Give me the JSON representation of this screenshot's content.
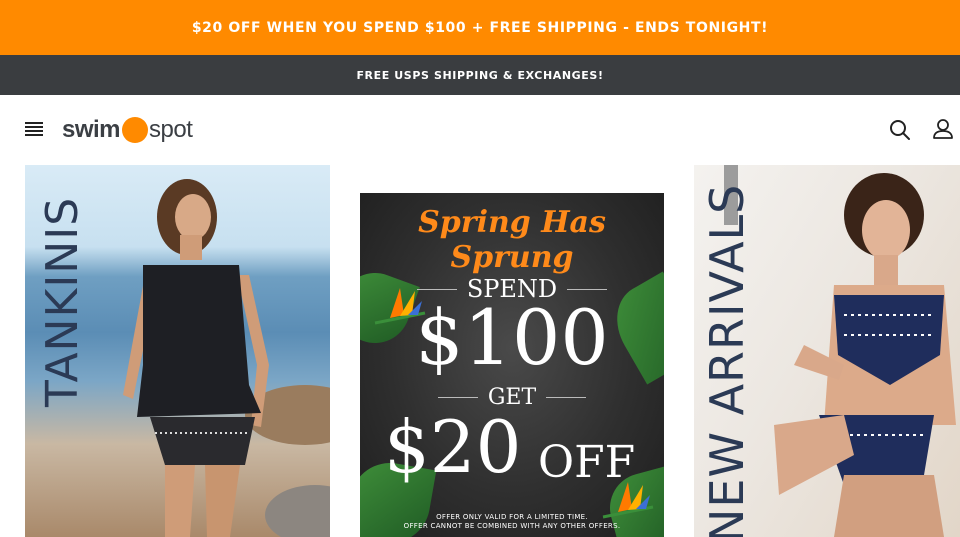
{
  "promo_bar": {
    "text": "$20 OFF WHEN YOU SPEND $100 + FREE SHIPPING - ENDS TONIGHT!"
  },
  "shipping_bar": {
    "text": "FREE USPS SHIPPING & EXCHANGES!"
  },
  "header": {
    "logo_swim": "swim",
    "logo_spot": "spot"
  },
  "tiles": {
    "tankinis": {
      "label": "TANKINIS"
    },
    "promo": {
      "title": "Spring Has Sprung",
      "spend": "SPEND",
      "amount_spend": "$100",
      "get": "GET",
      "amount_off": "$20",
      "off": "OFF",
      "fine_print_1": "OFFER ONLY VALID FOR A LIMITED TIME.",
      "fine_print_2": "OFFER CANNOT BE COMBINED WITH ANY OTHER OFFERS."
    },
    "new_arrivals": {
      "label": "NEW ARRIVALS"
    }
  },
  "colors": {
    "brand_orange": "#ff8a00",
    "dark_bar": "#3a3d40",
    "label_navy": "#2b3a55"
  },
  "icons": [
    "menu-icon",
    "search-icon",
    "account-icon"
  ]
}
